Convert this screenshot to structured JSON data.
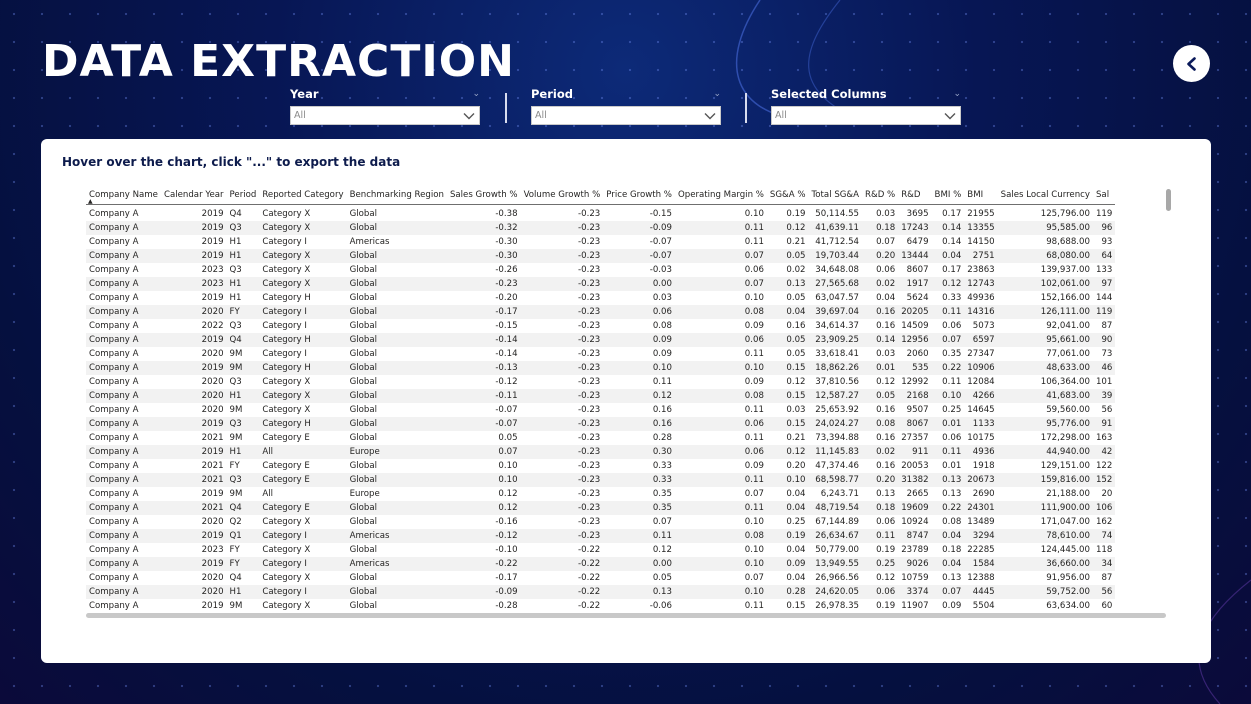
{
  "page_title": "DATA EXTRACTION",
  "filters": [
    {
      "label": "Year",
      "value": "All"
    },
    {
      "label": "Period",
      "value": "All"
    },
    {
      "label": "Selected Columns",
      "value": "All"
    }
  ],
  "hint_text": "Hover over the chart, click \"...\" to export the data",
  "table": {
    "columns": [
      "Company Name",
      "Calendar Year",
      "Period",
      "Reported Category",
      "Benchmarking Region",
      "Sales Growth %",
      "Volume Growth %",
      "Price Growth %",
      "Operating Margin %",
      "SG&A %",
      "Total SG&A",
      "R&D %",
      "R&D",
      "BMI %",
      "BMI",
      "Sales Local Currency",
      "Sal"
    ],
    "rows": [
      [
        "Company A",
        "2019",
        "Q4",
        "Category X",
        "Global",
        "-0.38",
        "-0.23",
        "-0.15",
        "0.10",
        "0.19",
        "50,114.55",
        "0.03",
        "3695",
        "0.17",
        "21955",
        "125,796.00",
        "119"
      ],
      [
        "Company A",
        "2019",
        "Q3",
        "Category X",
        "Global",
        "-0.32",
        "-0.23",
        "-0.09",
        "0.11",
        "0.12",
        "41,639.11",
        "0.18",
        "17243",
        "0.14",
        "13355",
        "95,585.00",
        "96"
      ],
      [
        "Company A",
        "2019",
        "H1",
        "Category I",
        "Americas",
        "-0.30",
        "-0.23",
        "-0.07",
        "0.11",
        "0.21",
        "41,712.54",
        "0.07",
        "6479",
        "0.14",
        "14150",
        "98,688.00",
        "93"
      ],
      [
        "Company A",
        "2019",
        "H1",
        "Category X",
        "Global",
        "-0.30",
        "-0.23",
        "-0.07",
        "0.07",
        "0.05",
        "19,703.44",
        "0.20",
        "13444",
        "0.04",
        "2751",
        "68,080.00",
        "64"
      ],
      [
        "Company A",
        "2023",
        "Q3",
        "Category X",
        "Global",
        "-0.26",
        "-0.23",
        "-0.03",
        "0.06",
        "0.02",
        "34,648.08",
        "0.06",
        "8607",
        "0.17",
        "23863",
        "139,937.00",
        "133"
      ],
      [
        "Company A",
        "2023",
        "H1",
        "Category X",
        "Global",
        "-0.23",
        "-0.23",
        "0.00",
        "0.07",
        "0.13",
        "27,565.68",
        "0.02",
        "1917",
        "0.12",
        "12743",
        "102,061.00",
        "97"
      ],
      [
        "Company A",
        "2019",
        "H1",
        "Category H",
        "Global",
        "-0.20",
        "-0.23",
        "0.03",
        "0.10",
        "0.05",
        "63,047.57",
        "0.04",
        "5624",
        "0.33",
        "49936",
        "152,166.00",
        "144"
      ],
      [
        "Company A",
        "2020",
        "FY",
        "Category I",
        "Global",
        "-0.17",
        "-0.23",
        "0.06",
        "0.08",
        "0.04",
        "39,697.04",
        "0.16",
        "20205",
        "0.11",
        "14316",
        "126,111.00",
        "119"
      ],
      [
        "Company A",
        "2022",
        "Q3",
        "Category I",
        "Global",
        "-0.15",
        "-0.23",
        "0.08",
        "0.09",
        "0.16",
        "34,614.37",
        "0.16",
        "14509",
        "0.06",
        "5073",
        "92,041.00",
        "87"
      ],
      [
        "Company A",
        "2019",
        "Q4",
        "Category H",
        "Global",
        "-0.14",
        "-0.23",
        "0.09",
        "0.06",
        "0.05",
        "23,909.25",
        "0.14",
        "12956",
        "0.07",
        "6597",
        "95,661.00",
        "90"
      ],
      [
        "Company A",
        "2020",
        "9M",
        "Category I",
        "Global",
        "-0.14",
        "-0.23",
        "0.09",
        "0.11",
        "0.05",
        "33,618.41",
        "0.03",
        "2060",
        "0.35",
        "27347",
        "77,061.00",
        "73"
      ],
      [
        "Company A",
        "2019",
        "9M",
        "Category H",
        "Global",
        "-0.13",
        "-0.23",
        "0.10",
        "0.10",
        "0.15",
        "18,862.26",
        "0.01",
        "535",
        "0.22",
        "10906",
        "48,633.00",
        "46"
      ],
      [
        "Company A",
        "2020",
        "Q3",
        "Category X",
        "Global",
        "-0.12",
        "-0.23",
        "0.11",
        "0.09",
        "0.12",
        "37,810.56",
        "0.12",
        "12992",
        "0.11",
        "12084",
        "106,364.00",
        "101"
      ],
      [
        "Company A",
        "2020",
        "H1",
        "Category X",
        "Global",
        "-0.11",
        "-0.23",
        "0.12",
        "0.08",
        "0.15",
        "12,587.27",
        "0.05",
        "2168",
        "0.10",
        "4266",
        "41,683.00",
        "39"
      ],
      [
        "Company A",
        "2020",
        "9M",
        "Category X",
        "Global",
        "-0.07",
        "-0.23",
        "0.16",
        "0.11",
        "0.03",
        "25,653.92",
        "0.16",
        "9507",
        "0.25",
        "14645",
        "59,560.00",
        "56"
      ],
      [
        "Company A",
        "2019",
        "Q3",
        "Category H",
        "Global",
        "-0.07",
        "-0.23",
        "0.16",
        "0.06",
        "0.15",
        "24,024.27",
        "0.08",
        "8067",
        "0.01",
        "1133",
        "95,776.00",
        "91"
      ],
      [
        "Company A",
        "2021",
        "9M",
        "Category E",
        "Global",
        "0.05",
        "-0.23",
        "0.28",
        "0.11",
        "0.21",
        "73,394.88",
        "0.16",
        "27357",
        "0.06",
        "10175",
        "172,298.00",
        "163"
      ],
      [
        "Company A",
        "2019",
        "H1",
        "All",
        "Europe",
        "0.07",
        "-0.23",
        "0.30",
        "0.06",
        "0.12",
        "11,145.83",
        "0.02",
        "911",
        "0.11",
        "4936",
        "44,940.00",
        "42"
      ],
      [
        "Company A",
        "2021",
        "FY",
        "Category E",
        "Global",
        "0.10",
        "-0.23",
        "0.33",
        "0.09",
        "0.20",
        "47,374.46",
        "0.16",
        "20053",
        "0.01",
        "1918",
        "129,151.00",
        "122"
      ],
      [
        "Company A",
        "2021",
        "Q3",
        "Category E",
        "Global",
        "0.10",
        "-0.23",
        "0.33",
        "0.11",
        "0.10",
        "68,598.77",
        "0.20",
        "31382",
        "0.13",
        "20673",
        "159,816.00",
        "152"
      ],
      [
        "Company A",
        "2019",
        "9M",
        "All",
        "Europe",
        "0.12",
        "-0.23",
        "0.35",
        "0.07",
        "0.04",
        "6,243.71",
        "0.13",
        "2665",
        "0.13",
        "2690",
        "21,188.00",
        "20"
      ],
      [
        "Company A",
        "2021",
        "Q4",
        "Category E",
        "Global",
        "0.12",
        "-0.23",
        "0.35",
        "0.11",
        "0.04",
        "48,719.54",
        "0.18",
        "19609",
        "0.22",
        "24301",
        "111,900.00",
        "106"
      ],
      [
        "Company A",
        "2020",
        "Q2",
        "Category X",
        "Global",
        "-0.16",
        "-0.23",
        "0.07",
        "0.10",
        "0.25",
        "67,144.89",
        "0.06",
        "10924",
        "0.08",
        "13489",
        "171,047.00",
        "162"
      ],
      [
        "Company A",
        "2019",
        "Q1",
        "Category I",
        "Americas",
        "-0.12",
        "-0.23",
        "0.11",
        "0.08",
        "0.19",
        "26,634.67",
        "0.11",
        "8747",
        "0.04",
        "3294",
        "78,610.00",
        "74"
      ],
      [
        "Company A",
        "2023",
        "FY",
        "Category X",
        "Global",
        "-0.10",
        "-0.22",
        "0.12",
        "0.10",
        "0.04",
        "50,779.00",
        "0.19",
        "23789",
        "0.18",
        "22285",
        "124,445.00",
        "118"
      ],
      [
        "Company A",
        "2019",
        "FY",
        "Category I",
        "Americas",
        "-0.22",
        "-0.22",
        "0.00",
        "0.10",
        "0.09",
        "13,949.55",
        "0.25",
        "9026",
        "0.04",
        "1584",
        "36,660.00",
        "34"
      ],
      [
        "Company A",
        "2020",
        "Q4",
        "Category X",
        "Global",
        "-0.17",
        "-0.22",
        "0.05",
        "0.07",
        "0.04",
        "26,966.56",
        "0.12",
        "10759",
        "0.13",
        "12388",
        "91,956.00",
        "87"
      ],
      [
        "Company A",
        "2020",
        "H1",
        "Category I",
        "Global",
        "-0.09",
        "-0.22",
        "0.13",
        "0.10",
        "0.28",
        "24,620.05",
        "0.06",
        "3374",
        "0.07",
        "4445",
        "59,752.00",
        "56"
      ],
      [
        "Company A",
        "2019",
        "9M",
        "Category X",
        "Global",
        "-0.28",
        "-0.22",
        "-0.06",
        "0.11",
        "0.15",
        "26,978.35",
        "0.19",
        "11907",
        "0.09",
        "5504",
        "63,634.00",
        "60"
      ]
    ]
  }
}
